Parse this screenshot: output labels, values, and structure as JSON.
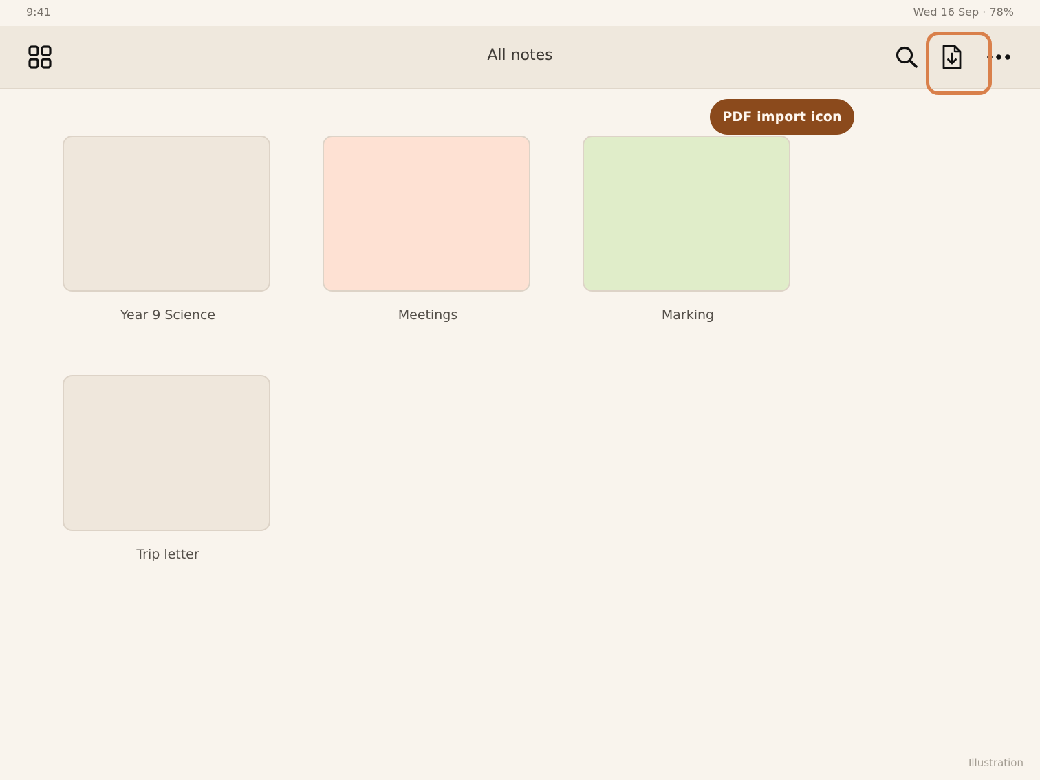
{
  "status_bar": {
    "time": "9:41",
    "date_battery": "Wed 16 Sep · 78%"
  },
  "toolbar": {
    "title": "All notes",
    "icons": {
      "grid": "grid-view-icon",
      "search": "search-icon",
      "import": "pdf-import-icon",
      "more": "more-options-icon"
    }
  },
  "tooltip": {
    "label": "PDF import icon"
  },
  "notes": [
    {
      "title": "Year 9 Science",
      "color": "#efe7dc"
    },
    {
      "title": "Meetings",
      "color": "#fee1d3"
    },
    {
      "title": "Marking",
      "color": "#e0edc9"
    },
    {
      "title": "Trip letter",
      "color": "#efe7dc"
    }
  ],
  "colors": {
    "highlight": "#d9804b",
    "tooltip_bg": "#8b4a1c"
  },
  "footer": {
    "caption": "Illustration"
  }
}
